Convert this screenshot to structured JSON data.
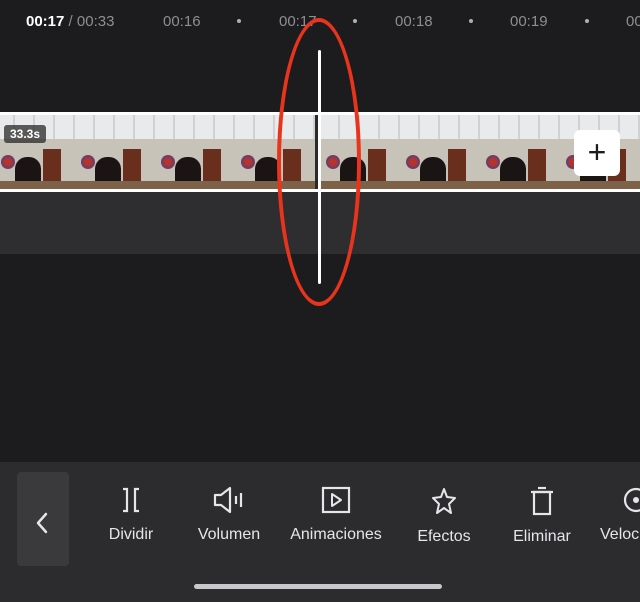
{
  "timeline": {
    "current_time": "00:17",
    "separator": " / ",
    "total_time": "00:33",
    "ticks": [
      "00:16",
      "00:17",
      "00:18",
      "00:19",
      "00:"
    ]
  },
  "clip": {
    "duration_label": "33.3s",
    "add_label": "+"
  },
  "toolbar": {
    "items": [
      {
        "label": "Dividir",
        "icon": "split-icon"
      },
      {
        "label": "Volumen",
        "icon": "volume-icon"
      },
      {
        "label": "Animaciones",
        "icon": "play-box-icon"
      },
      {
        "label": "Efectos",
        "icon": "sparkle-icon"
      },
      {
        "label": "Eliminar",
        "icon": "trash-icon"
      },
      {
        "label": "Veloc",
        "icon": "speed-icon"
      }
    ]
  },
  "colors": {
    "background": "#1c1c1e",
    "toolbar": "#2c2c2e",
    "annotation": "#e8341c",
    "playhead": "#ffffff"
  }
}
